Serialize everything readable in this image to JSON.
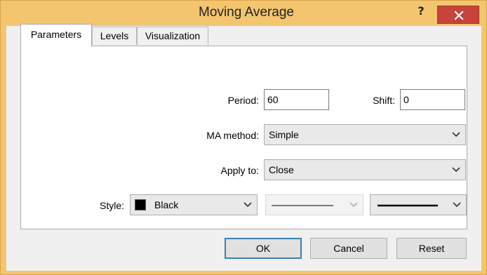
{
  "window": {
    "title": "Moving Average",
    "help_glyph": "?"
  },
  "tabs": [
    {
      "label": "Parameters",
      "active": true
    },
    {
      "label": "Levels",
      "active": false
    },
    {
      "label": "Visualization",
      "active": false
    }
  ],
  "params": {
    "period_label": "Period:",
    "period_value": "60",
    "shift_label": "Shift:",
    "shift_value": "0",
    "ma_method_label": "MA method:",
    "ma_method_value": "Simple",
    "apply_to_label": "Apply to:",
    "apply_to_value": "Close",
    "style_label": "Style:",
    "style_color_value": "Black",
    "style_color_hex": "#000000"
  },
  "buttons": {
    "ok": "OK",
    "cancel": "Cancel",
    "reset": "Reset"
  },
  "colors": {
    "frame": "#f3c56e",
    "close": "#c6443b",
    "default_button_border": "#3c7fb1"
  }
}
